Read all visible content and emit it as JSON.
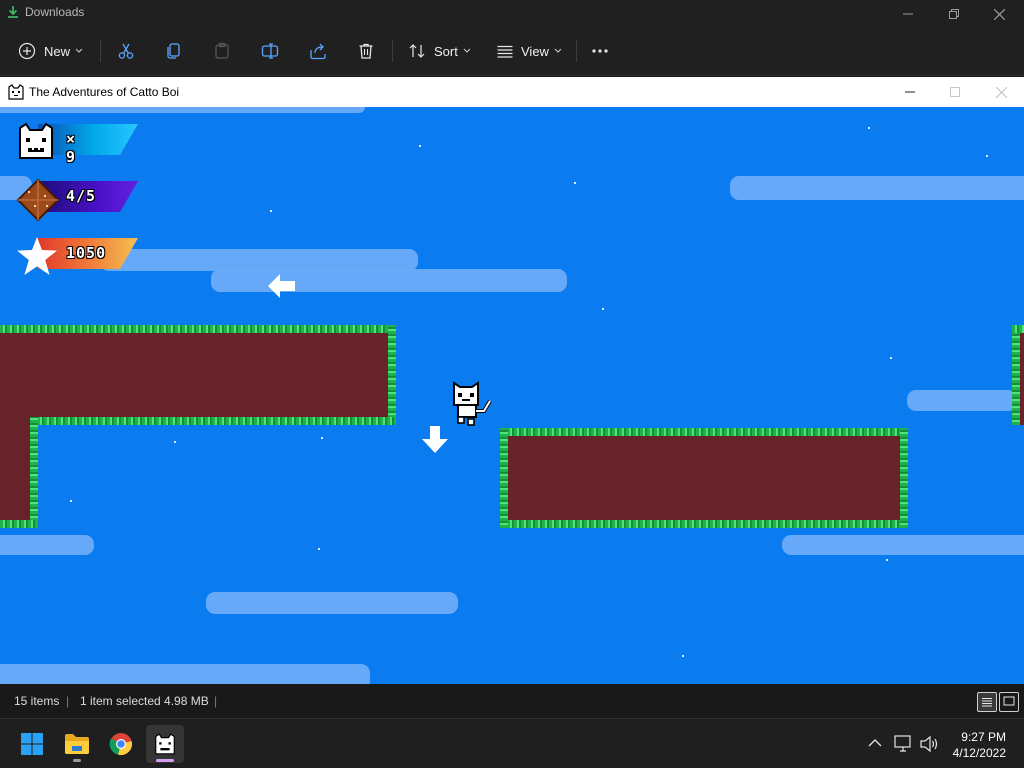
{
  "explorer": {
    "title": "Downloads",
    "toolbar": {
      "new_label": "New",
      "sort_label": "Sort",
      "view_label": "View"
    }
  },
  "game_window": {
    "title": "The Adventures of Catto Boi"
  },
  "hud": {
    "lives": "× 9",
    "gems": "4/5",
    "score": "1050"
  },
  "status_bar": {
    "item_count": "15 items",
    "selection": "1 item selected  4.98 MB"
  },
  "taskbar": {
    "time": "9:27 PM",
    "date": "4/12/2022"
  },
  "colors": {
    "sky": "#0b7bf0",
    "platform": "#66232a",
    "grass": "#1fb34a",
    "hud_lives": "#00a8e8",
    "hud_gems": "#4a10c8",
    "hud_score": "#f0803c"
  }
}
